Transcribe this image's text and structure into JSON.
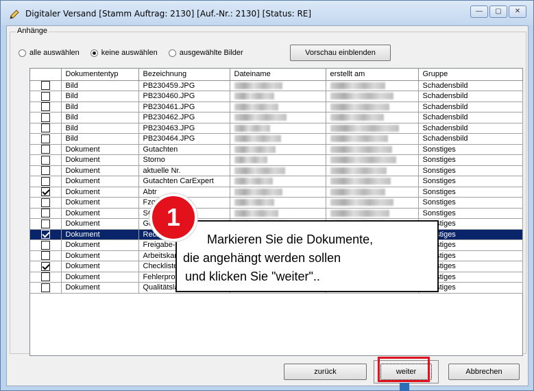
{
  "window": {
    "title": "Digitaler Versand [Stamm Auftrag: 2130]  [Auf.-Nr.: 2130]  [Status: RE]",
    "buttons": [
      "—",
      "▢",
      "✕"
    ]
  },
  "attachments": {
    "group_label": "Anhänge",
    "radio_options": [
      {
        "label": "alle auswählen",
        "selected": false
      },
      {
        "label": "keine auswählen",
        "selected": true
      },
      {
        "label": "ausgewählte Bilder",
        "selected": false
      }
    ],
    "preview_button": "Vorschau einblenden"
  },
  "table": {
    "columns": [
      "",
      "Dokumententyp",
      "Bezeichnung",
      "Dateiname",
      "erstellt am",
      "Gruppe"
    ],
    "rows": [
      {
        "checked": false,
        "type": "Bild",
        "name": "PB230459.JPG",
        "group": "Schadensbild",
        "selected": false
      },
      {
        "checked": false,
        "type": "Bild",
        "name": "PB230460.JPG",
        "group": "Schadensbild",
        "selected": false
      },
      {
        "checked": false,
        "type": "Bild",
        "name": "PB230461.JPG",
        "group": "Schadensbild",
        "selected": false
      },
      {
        "checked": false,
        "type": "Bild",
        "name": "PB230462.JPG",
        "group": "Schadensbild",
        "selected": false
      },
      {
        "checked": false,
        "type": "Bild",
        "name": "PB230463.JPG",
        "group": "Schadensbild",
        "selected": false
      },
      {
        "checked": false,
        "type": "Bild",
        "name": "PB230464.JPG",
        "group": "Schadensbild",
        "selected": false
      },
      {
        "checked": false,
        "type": "Dokument",
        "name": "Gutachten",
        "group": "Sonstiges",
        "selected": false
      },
      {
        "checked": false,
        "type": "Dokument",
        "name": "Storno",
        "group": "Sonstiges",
        "selected": false
      },
      {
        "checked": false,
        "type": "Dokument",
        "name": "aktuelle Nr.",
        "group": "Sonstiges",
        "selected": false
      },
      {
        "checked": false,
        "type": "Dokument",
        "name": "Gutachten CarExpert",
        "group": "Sonstiges",
        "selected": false
      },
      {
        "checked": true,
        "type": "Dokument",
        "name": "Abtr",
        "group": "Sonstiges",
        "selected": false
      },
      {
        "checked": false,
        "type": "Dokument",
        "name": "Fzg",
        "group": "Sonstiges",
        "selected": false
      },
      {
        "checked": false,
        "type": "Dokument",
        "name": "SC2",
        "group": "Sonstiges",
        "selected": false
      },
      {
        "checked": false,
        "type": "Dokument",
        "name": "Gutschrift",
        "group": "Sonstiges",
        "selected": false
      },
      {
        "checked": true,
        "type": "Dokument",
        "name": "Rechnung",
        "group": "Sonstiges",
        "selected": true
      },
      {
        "checked": false,
        "type": "Dokument",
        "name": "Freigabe-E",
        "group": "Sonstiges",
        "selected": false
      },
      {
        "checked": false,
        "type": "Dokument",
        "name": "Arbeitskart",
        "group": "Sonstiges",
        "selected": false
      },
      {
        "checked": true,
        "type": "Dokument",
        "name": "Checkliste",
        "group": "Sonstiges",
        "selected": false
      },
      {
        "checked": false,
        "type": "Dokument",
        "name": "Fehlerprotokoll",
        "group": "Sonstiges",
        "selected": false
      },
      {
        "checked": false,
        "type": "Dokument",
        "name": "Qualitätslaufkarte",
        "group": "Sonstiges",
        "selected": false
      }
    ]
  },
  "footer": {
    "back": "zurück",
    "next": "weiter",
    "cancel": "Abbrechen"
  },
  "callout": {
    "number": "1",
    "line1": "Markieren Sie die Dokumente,",
    "line2": "die angehängt werden sollen",
    "line3": "und klicken Sie \"weiter\".."
  },
  "colors": {
    "selection": "#0a246a",
    "highlight": "#e0121f",
    "badge": "#e3111c"
  }
}
